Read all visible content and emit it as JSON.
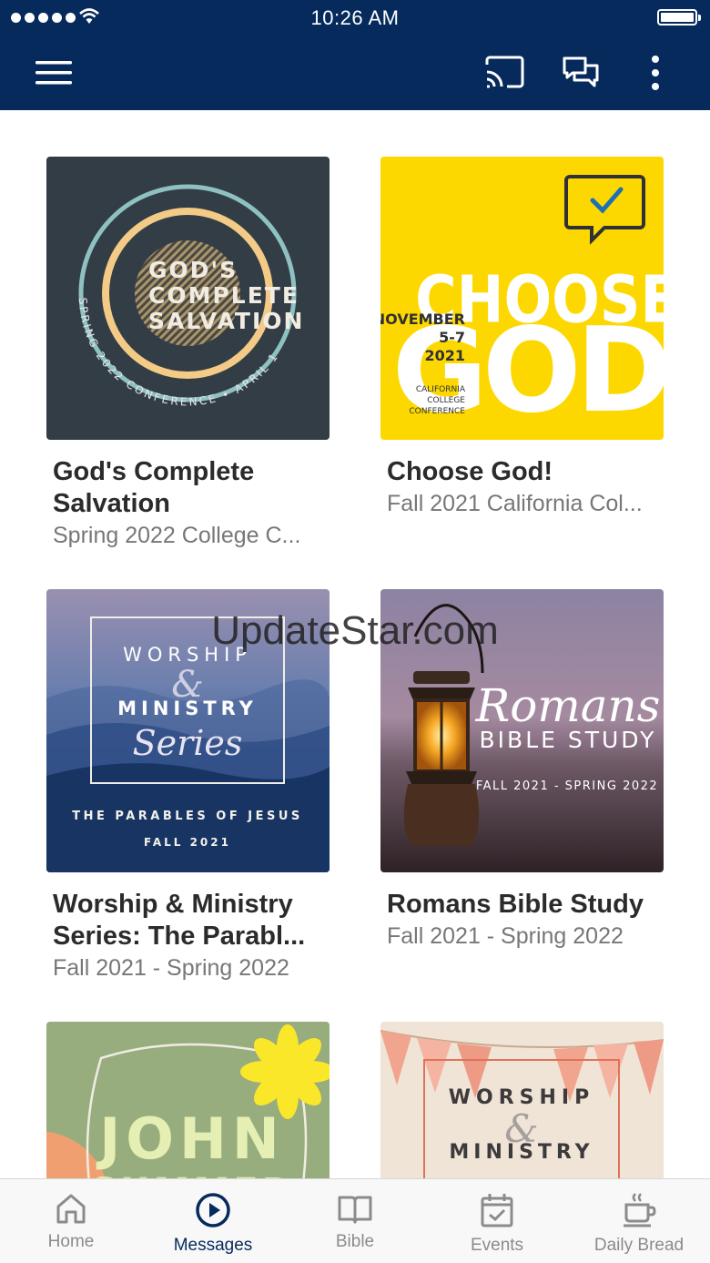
{
  "status_bar": {
    "time": "10:26 AM"
  },
  "watermark": "UpdateStar.com",
  "cards": [
    {
      "title": "God's Complete Salvation",
      "subtitle": "Spring 2022 College C...",
      "art": {
        "line1": "GOD'S",
        "line2": "COMPLETE",
        "line3": "SALVATION",
        "arc": "SPRING 2022 CONFERENCE • APRIL 15-16"
      }
    },
    {
      "title": "Choose God!",
      "subtitle": "Fall 2021 California Col...",
      "art": {
        "big1": "CHOOSE",
        "big2": "GOD!",
        "date1": "NOVEMBER",
        "date2": "5-7",
        "date3": "2021",
        "org1": "CALIFORNIA",
        "org2": "COLLEGE",
        "org3": "CONFERENCE"
      }
    },
    {
      "title": "Worship & Ministry Series: The Parabl...",
      "subtitle": "Fall 2021 - Spring 2022",
      "art": {
        "w1": "WORSHIP",
        "amp": "&",
        "w2": "MINISTRY",
        "script": "Series",
        "sub": "THE PARABLES OF JESUS",
        "season": "FALL 2021"
      }
    },
    {
      "title": "Romans Bible Study",
      "subtitle": "Fall 2021 - Spring 2022",
      "art": {
        "script": "Romans",
        "line": "BIBLE STUDY",
        "season": "FALL 2021 - SPRING 2022"
      }
    },
    {
      "art": {
        "line1": "JOHN",
        "line2": "SUMMER"
      }
    },
    {
      "art": {
        "w1": "WORSHIP",
        "amp": "&",
        "w2": "MINISTRY"
      }
    }
  ],
  "bottom_nav": [
    {
      "label": "Home",
      "icon": "home-icon",
      "active": false
    },
    {
      "label": "Messages",
      "icon": "play-circle-icon",
      "active": true
    },
    {
      "label": "Bible",
      "icon": "book-icon",
      "active": false
    },
    {
      "label": "Events",
      "icon": "calendar-check-icon",
      "active": false
    },
    {
      "label": "Daily Bread",
      "icon": "coffee-cup-icon",
      "active": false
    }
  ],
  "colors": {
    "navy": "#062a5c",
    "yellow": "#fdd800",
    "active_tab": "#062a5c",
    "inactive_tab": "#8b8b8b"
  }
}
